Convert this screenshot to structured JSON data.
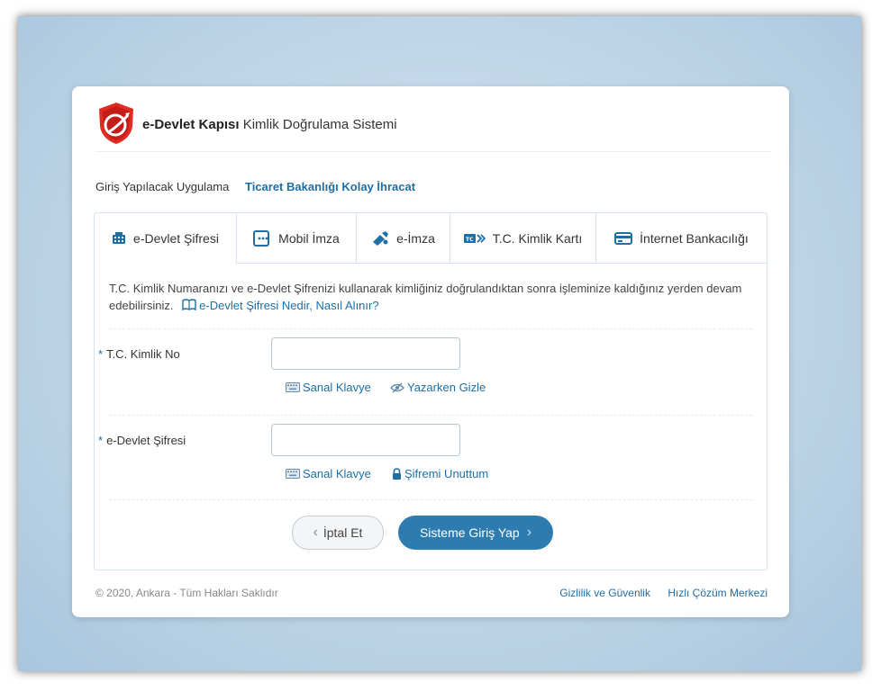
{
  "header": {
    "brand_bold": "e-Devlet Kapısı",
    "brand_rest": " Kimlik Doğrulama Sistemi"
  },
  "app": {
    "label": "Giriş Yapılacak Uygulama",
    "name": "Ticaret Bakanlığı Kolay İhracat"
  },
  "tabs": [
    {
      "label": "e-Devlet Şifresi",
      "icon": "keypad-icon",
      "active": true
    },
    {
      "label": "Mobil İmza",
      "icon": "mobile-signature-icon"
    },
    {
      "label": "e-İmza",
      "icon": "usb-token-icon"
    },
    {
      "label": "T.C. Kimlik Kartı",
      "icon": "id-card-icon"
    },
    {
      "label": "İnternet Bankacılığı",
      "icon": "bank-card-icon"
    }
  ],
  "description": {
    "text": "T.C. Kimlik Numaranızı ve e-Devlet Şifrenizi kullanarak kimliğiniz doğrulandıktan sonra işleminize kaldığınız yerden devam edebilirsiniz.",
    "help_link": "e-Devlet Şifresi Nedir, Nasıl Alınır?"
  },
  "form": {
    "tc_label": "T.C. Kimlik No",
    "tc_value": "",
    "password_label": "e-Devlet Şifresi",
    "password_value": "",
    "required_mark": "*",
    "virtual_keyboard": "Sanal Klavye",
    "hide_while_typing": "Yazarken Gizle",
    "forgot_password": "Şifremi Unuttum"
  },
  "buttons": {
    "cancel": "İptal Et",
    "submit": "Sisteme Giriş Yap"
  },
  "footer": {
    "copyright": "© 2020, Ankara - Tüm Hakları Saklıdır",
    "privacy": "Gizlilik ve Güvenlik",
    "help_center": "Hızlı Çözüm Merkezi"
  },
  "colors": {
    "accent": "#1d6fa5",
    "submit_bg": "#2e7bb0",
    "logo_red": "#e02a22"
  }
}
